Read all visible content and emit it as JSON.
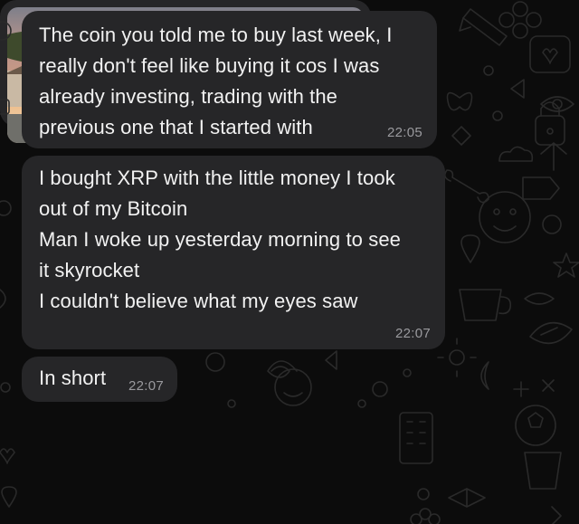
{
  "messages": [
    {
      "lines": [
        "The coin you told me to buy last week, I",
        "really don't feel like buying it cos I was",
        "already investing, trading with the",
        "previous one that I started with"
      ],
      "time": "22:05"
    },
    {
      "lines": [
        "I bought XRP with the little money I took",
        "out of my Bitcoin",
        "Man I woke up yesterday morning to see",
        "it skyrocket",
        "I couldn't believe what my eyes saw"
      ],
      "time": "22:07"
    },
    {
      "lines": [
        "In short"
      ],
      "time": "22:07"
    }
  ],
  "colors": {
    "background": "#0c0c0c",
    "bubble": "#262628",
    "text": "#f2f2f2",
    "timestamp": "#9a9a9e"
  },
  "icons": [
    "doodle-wallpaper-icons"
  ]
}
